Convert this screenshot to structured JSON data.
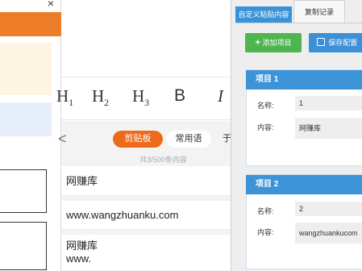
{
  "left_panel": {
    "close_label": "×"
  },
  "toolbar": {
    "h1": "H",
    "h1_sub": "1",
    "h2": "H",
    "h2_sub": "2",
    "h3": "H",
    "h3_sub": "3",
    "bold": "B",
    "italic_cut": "I"
  },
  "clipboard": {
    "back": "<",
    "tab_clipboard": "剪贴板",
    "tab_phrases": "常用语",
    "tab_cut": "于",
    "count_text": "共3/500条内容",
    "items": [
      {
        "line1": "网赚库",
        "line2": ""
      },
      {
        "line1": "www.wangzhuanku.com",
        "line2": ""
      },
      {
        "line1": "网赚库",
        "line2": "www."
      }
    ]
  },
  "settings": {
    "tab_custom": "自定义粘贴内容",
    "tab_history": "复制记录",
    "add_button": "添加项目",
    "add_icon": "+",
    "save_button": "保存配置",
    "save_icon": "💾",
    "projects": [
      {
        "title": "项目 1",
        "name_label": "名称:",
        "name_value": "1",
        "content_label": "内容:",
        "content_value": "网赚库"
      },
      {
        "title": "项目 2",
        "name_label": "名称:",
        "name_value": "2",
        "content_label": "内容:",
        "content_value": "wangzhuankucom"
      }
    ]
  }
}
